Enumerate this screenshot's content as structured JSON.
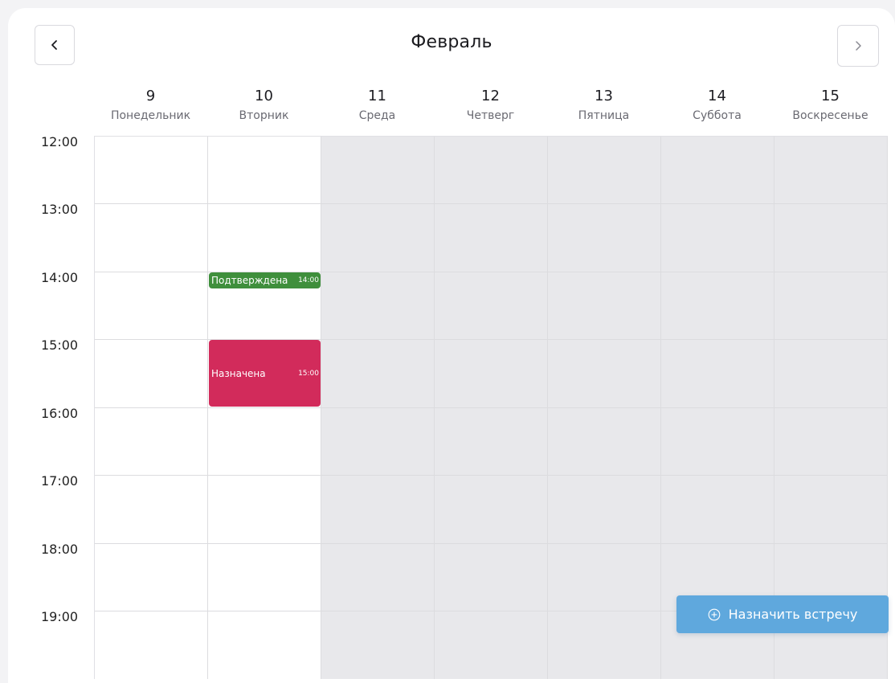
{
  "header": {
    "month": "Февраль",
    "prev_icon": "chevron-left-icon",
    "next_icon": "chevron-right-icon"
  },
  "days": [
    {
      "num": "9",
      "name": "Понедельник",
      "available": true
    },
    {
      "num": "10",
      "name": "Вторник",
      "available": true
    },
    {
      "num": "11",
      "name": "Среда",
      "available": false
    },
    {
      "num": "12",
      "name": "Четверг",
      "available": false
    },
    {
      "num": "13",
      "name": "Пятница",
      "available": false
    },
    {
      "num": "14",
      "name": "Суббота",
      "available": false
    },
    {
      "num": "15",
      "name": "Воскресенье",
      "available": false
    }
  ],
  "times": [
    "12:00",
    "13:00",
    "14:00",
    "15:00",
    "16:00",
    "17:00",
    "18:00",
    "19:00"
  ],
  "events": [
    {
      "label": "Подтверждена",
      "time": "14:00",
      "day_index": 1,
      "color": "#3f8f3c"
    },
    {
      "label": "Назначена",
      "time": "15:00",
      "day_index": 1,
      "color": "#d22b5b"
    }
  ],
  "cta": {
    "label": "Назначить встречу",
    "icon": "plus-circle-icon",
    "color": "#5fa8dd"
  },
  "colors": {
    "disabled_cell": "#e8e8eb",
    "grid_line": "#dcdcdf"
  }
}
